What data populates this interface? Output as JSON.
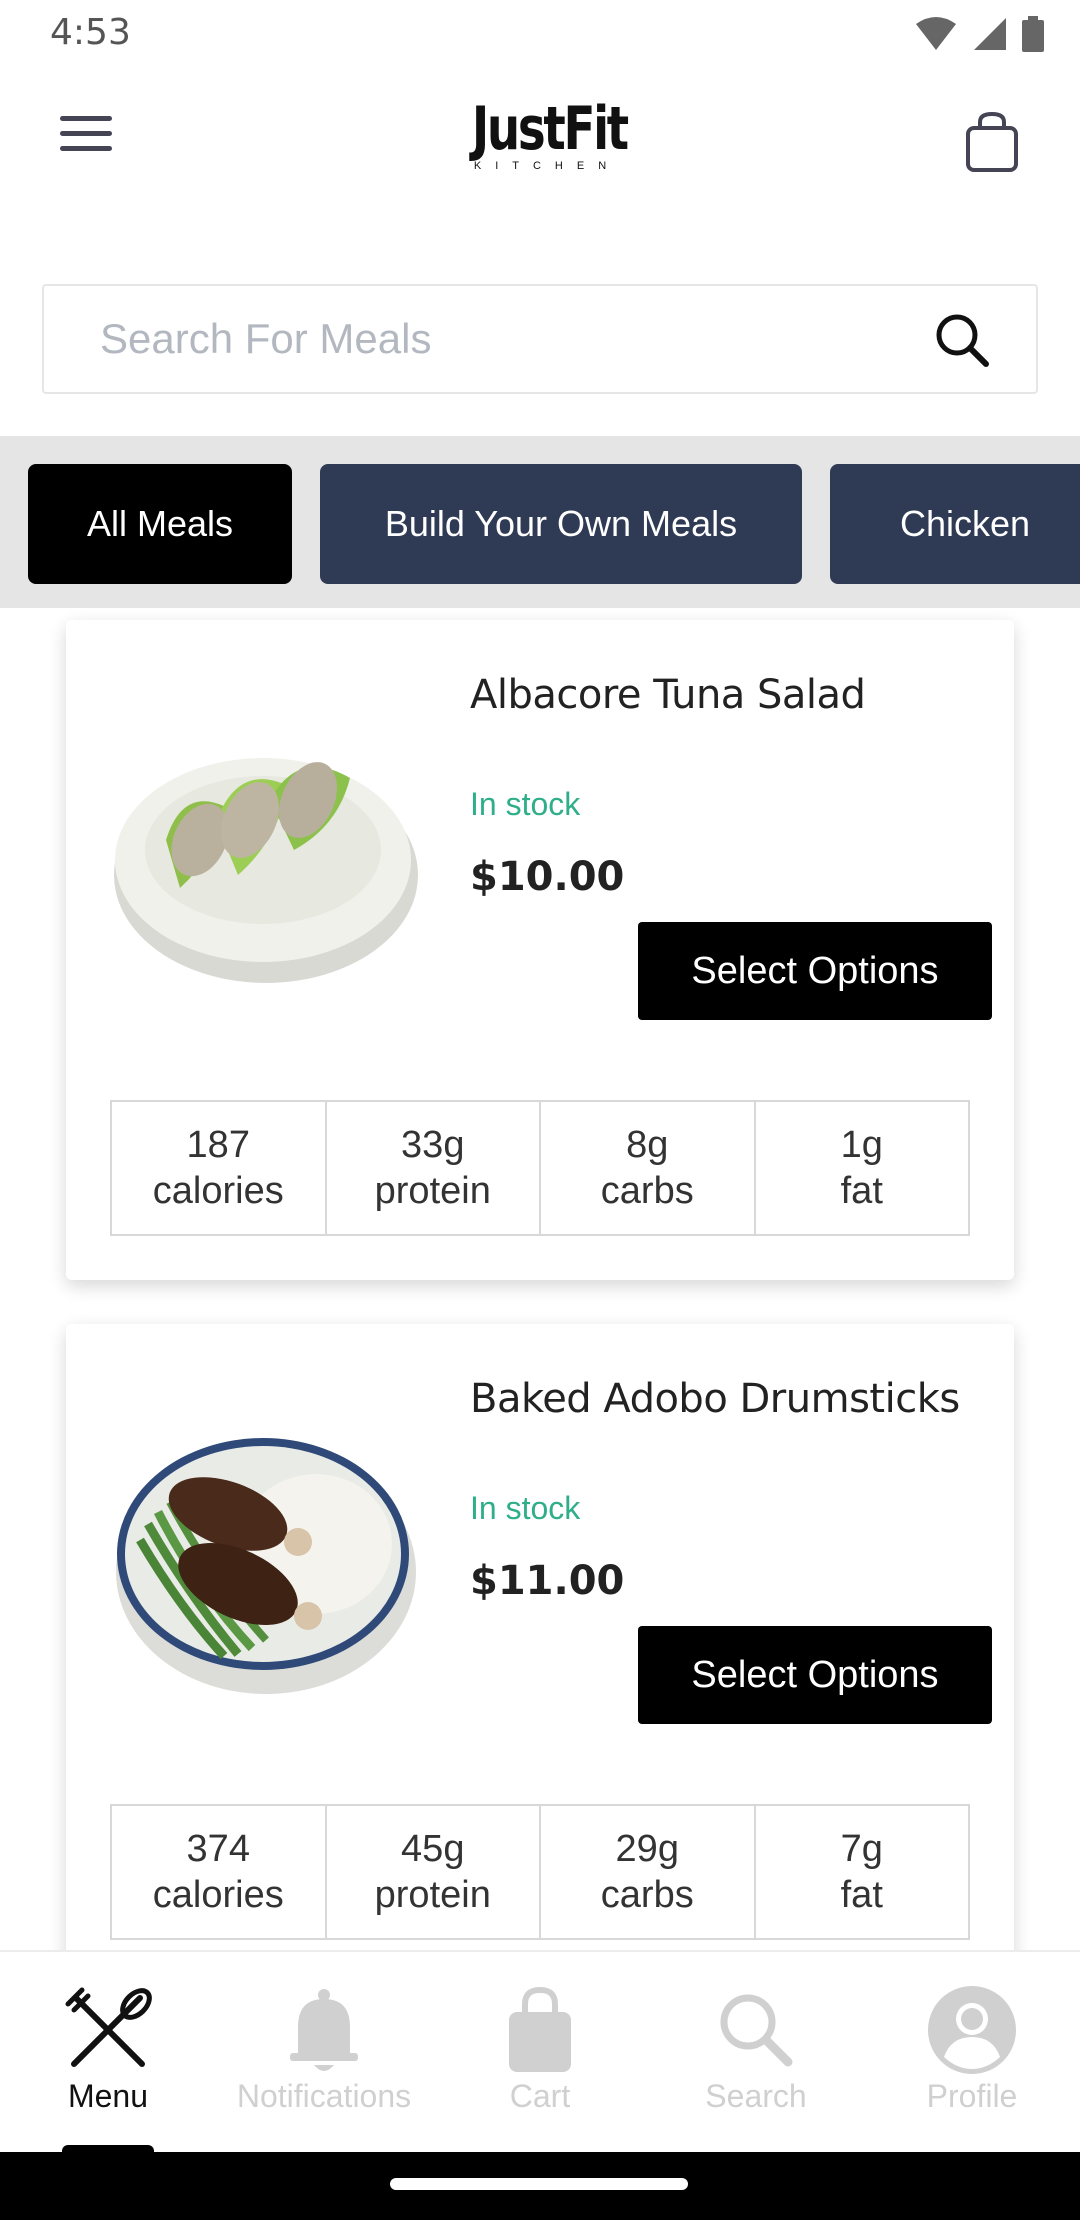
{
  "status_bar": {
    "time": "4:53",
    "icons": [
      "wifi-icon",
      "signal-icon",
      "battery-icon"
    ]
  },
  "header": {
    "menu_icon": "hamburger-menu-icon",
    "logo_text": "JustFit",
    "logo_subtext": "KITCHEN",
    "cart_icon": "shopping-bag-icon"
  },
  "search": {
    "placeholder": "Search For Meals",
    "icon": "search-icon"
  },
  "categories": [
    {
      "label": "All Meals",
      "active": true
    },
    {
      "label": "Build Your Own Meals",
      "active": false
    },
    {
      "label": "Chicken",
      "active": false
    }
  ],
  "meals": [
    {
      "name": "Albacore Tuna Salad",
      "stock": "In stock",
      "price": "$10.00",
      "button": "Select Options",
      "nutrition": [
        {
          "value": "187",
          "unit": "calories"
        },
        {
          "value": "33g",
          "unit": "protein"
        },
        {
          "value": "8g",
          "unit": "carbs"
        },
        {
          "value": "1g",
          "unit": "fat"
        }
      ]
    },
    {
      "name": "Baked Adobo Drumsticks",
      "stock": "In stock",
      "price": "$11.00",
      "button": "Select Options",
      "nutrition": [
        {
          "value": "374",
          "unit": "calories"
        },
        {
          "value": "45g",
          "unit": "protein"
        },
        {
          "value": "29g",
          "unit": "carbs"
        },
        {
          "value": "7g",
          "unit": "fat"
        }
      ]
    }
  ],
  "bottom_nav": [
    {
      "label": "Menu",
      "icon": "fork-knife-icon",
      "active": true
    },
    {
      "label": "Notifications",
      "icon": "bell-icon",
      "active": false
    },
    {
      "label": "Cart",
      "icon": "shopping-bag-icon",
      "active": false
    },
    {
      "label": "Search",
      "icon": "search-icon",
      "active": false
    },
    {
      "label": "Profile",
      "icon": "profile-icon",
      "active": false
    }
  ],
  "colors": {
    "stock_green": "#2fae8a",
    "chip_inactive": "#2f3a55",
    "chip_active": "#000000",
    "category_bg": "#e5e5e5"
  }
}
